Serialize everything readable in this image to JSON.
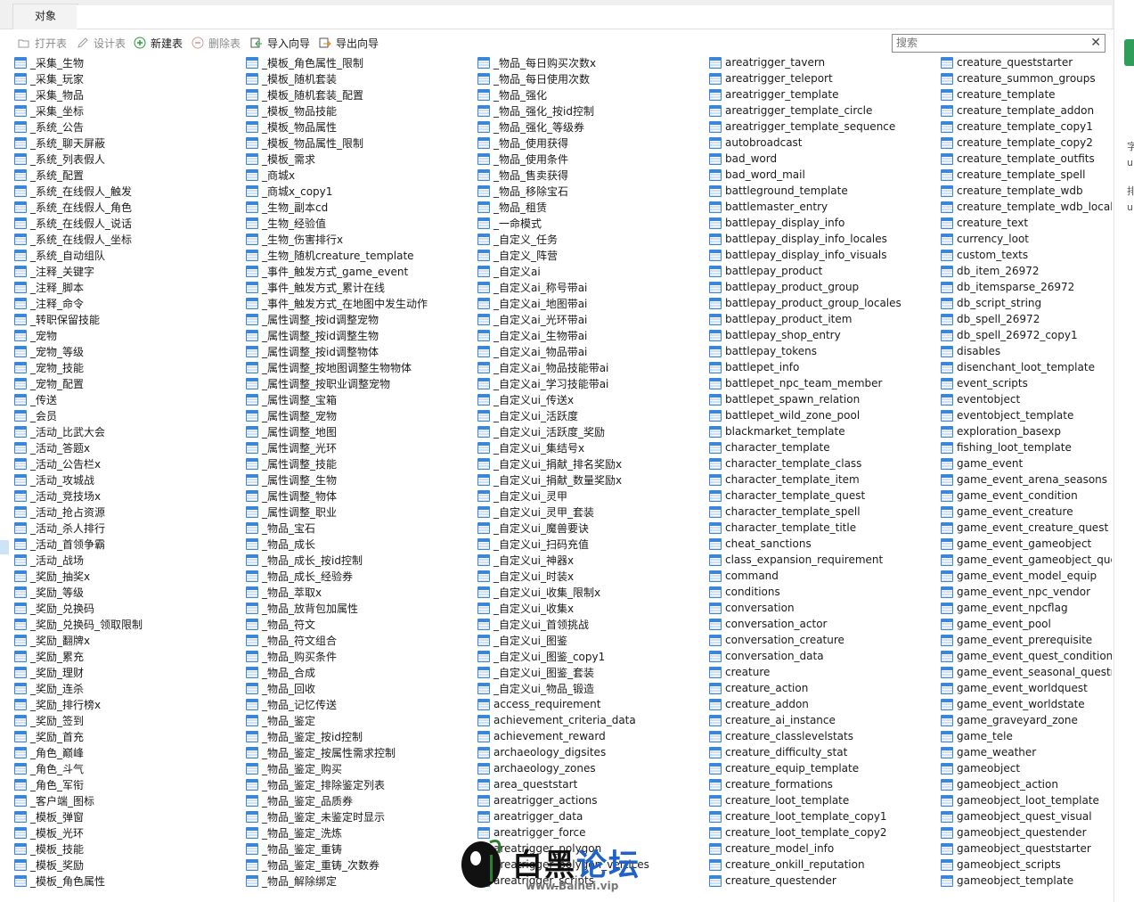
{
  "tab": {
    "label": "对象"
  },
  "toolbar": {
    "open": "打开表",
    "design": "设计表",
    "new": "新建表",
    "delete": "删除表",
    "import": "导入向导",
    "export": "导出向导"
  },
  "search": {
    "placeholder": "搜索"
  },
  "sidebar": {
    "t1": "字",
    "t2": "u",
    "t3": "排",
    "t4": "u"
  },
  "watermark": {
    "title_dark": "白黑",
    "title_blue": "论坛",
    "url": "www.Baihei.vip"
  },
  "columns": [
    [
      "_采集_生物",
      "_采集_玩家",
      "_采集_物品",
      "_采集_坐标",
      "_系统_公告",
      "_系统_聊天屏蔽",
      "_系统_列表假人",
      "_系统_配置",
      "_系统_在线假人_触发",
      "_系统_在线假人_角色",
      "_系统_在线假人_说话",
      "_系统_在线假人_坐标",
      "_系统_自动组队",
      "_注释_关键字",
      "_注释_脚本",
      "_注释_命令",
      "_转职保留技能",
      "_宠物",
      "_宠物_等级",
      "_宠物_技能",
      "_宠物_配置",
      "_传送",
      "_会员",
      "_活动_比武大会",
      "_活动_答题x",
      "_活动_公告栏x",
      "_活动_攻城战",
      "_活动_竞技场x",
      "_活动_抢占资源",
      "_活动_杀人排行",
      "_活动_首领争霸",
      "_活动_战场",
      "_奖励_抽奖x",
      "_奖励_等级",
      "_奖励_兑换码",
      "_奖励_兑换码_领取限制",
      "_奖励_翻牌x",
      "_奖励_累充",
      "_奖励_理财",
      "_奖励_连杀",
      "_奖励_排行榜x",
      "_奖励_签到",
      "_奖励_首充",
      "_角色_巅峰",
      "_角色_斗气",
      "_角色_军衔",
      "_客户端_图标",
      "_模板_弹窗",
      "_模板_光环",
      "_模板_技能",
      "_模板_奖励",
      "_模板_角色属性"
    ],
    [
      "_模板_角色属性_限制",
      "_模板_随机套装",
      "_模板_随机套装_配置",
      "_模板_物品技能",
      "_模板_物品属性",
      "_模板_物品属性_限制",
      "_模板_需求",
      "_商城x",
      "_商城x_copy1",
      "_生物_副本cd",
      "_生物_经验值",
      "_生物_伤害排行x",
      "_生物_随机creature_template",
      "_事件_触发方式_game_event",
      "_事件_触发方式_累计在线",
      "_事件_触发方式_在地图中发生动作",
      "_属性调整_按id调整宠物",
      "_属性调整_按id调整生物",
      "_属性调整_按id调整物体",
      "_属性调整_按地图调整生物物体",
      "_属性调整_按职业调整宠物",
      "_属性调整_宝箱",
      "_属性调整_宠物",
      "_属性调整_地图",
      "_属性调整_光环",
      "_属性调整_技能",
      "_属性调整_生物",
      "_属性调整_物体",
      "_属性调整_职业",
      "_物品_宝石",
      "_物品_成长",
      "_物品_成长_按id控制",
      "_物品_成长_经验券",
      "_物品_萃取x",
      "_物品_放背包加属性",
      "_物品_符文",
      "_物品_符文组合",
      "_物品_购买条件",
      "_物品_合成",
      "_物品_回收",
      "_物品_记忆传送",
      "_物品_鉴定",
      "_物品_鉴定_按id控制",
      "_物品_鉴定_按属性需求控制",
      "_物品_鉴定_购买",
      "_物品_鉴定_排除鉴定列表",
      "_物品_鉴定_品质券",
      "_物品_鉴定_未鉴定时显示",
      "_物品_鉴定_洗炼",
      "_物品_鉴定_重铸",
      "_物品_鉴定_重铸_次数券",
      "_物品_解除绑定"
    ],
    [
      "_物品_每日购买次数x",
      "_物品_每日使用次数",
      "_物品_强化",
      "_物品_强化_按id控制",
      "_物品_强化_等级券",
      "_物品_使用获得",
      "_物品_使用条件",
      "_物品_售卖获得",
      "_物品_移除宝石",
      "_物品_租赁",
      "_一命模式",
      "_自定义_任务",
      "_自定义_阵营",
      "_自定义ai",
      "_自定义ai_称号带ai",
      "_自定义ai_地图带ai",
      "_自定义ai_光环带ai",
      "_自定义ai_生物带ai",
      "_自定义ai_物品带ai",
      "_自定义ai_物品技能带ai",
      "_自定义ai_学习技能带ai",
      "_自定义ui_传送x",
      "_自定义ui_活跃度",
      "_自定义ui_活跃度_奖励",
      "_自定义ui_集结号x",
      "_自定义ui_捐献_排名奖励x",
      "_自定义ui_捐献_数量奖励x",
      "_自定义ui_灵甲",
      "_自定义ui_灵甲_套装",
      "_自定义ui_魔兽要诀",
      "_自定义ui_扫码充值",
      "_自定义ui_神器x",
      "_自定义ui_时装x",
      "_自定义ui_收集_限制x",
      "_自定义ui_收集x",
      "_自定义ui_首领挑战",
      "_自定义ui_图鉴",
      "_自定义ui_图鉴_copy1",
      "_自定义ui_图鉴_套装",
      "_自定义ui_物品_锻造",
      "access_requirement",
      "achievement_criteria_data",
      "achievement_reward",
      "archaeology_digsites",
      "archaeology_zones",
      "area_queststart",
      "areatrigger_actions",
      "areatrigger_data",
      "areatrigger_force",
      "areatrigger_polygon",
      "areatrigger_polygon_vertices",
      "areatrigger_scripts"
    ],
    [
      "areatrigger_tavern",
      "areatrigger_teleport",
      "areatrigger_template",
      "areatrigger_template_circle",
      "areatrigger_template_sequence",
      "autobroadcast",
      "bad_word",
      "bad_word_mail",
      "battleground_template",
      "battlemaster_entry",
      "battlepay_display_info",
      "battlepay_display_info_locales",
      "battlepay_display_info_visuals",
      "battlepay_product",
      "battlepay_product_group",
      "battlepay_product_group_locales",
      "battlepay_product_item",
      "battlepay_shop_entry",
      "battlepay_tokens",
      "battlepet_info",
      "battlepet_npc_team_member",
      "battlepet_spawn_relation",
      "battlepet_wild_zone_pool",
      "blackmarket_template",
      "character_template",
      "character_template_class",
      "character_template_item",
      "character_template_quest",
      "character_template_spell",
      "character_template_title",
      "cheat_sanctions",
      "class_expansion_requirement",
      "command",
      "conditions",
      "conversation",
      "conversation_actor",
      "conversation_creature",
      "conversation_data",
      "creature",
      "creature_action",
      "creature_addon",
      "creature_ai_instance",
      "creature_classlevelstats",
      "creature_difficulty_stat",
      "creature_equip_template",
      "creature_formations",
      "creature_loot_template",
      "creature_loot_template_copy1",
      "creature_loot_template_copy2",
      "creature_model_info",
      "creature_onkill_reputation",
      "creature_questender"
    ],
    [
      "creature_queststarter",
      "creature_summon_groups",
      "creature_template",
      "creature_template_addon",
      "creature_template_copy1",
      "creature_template_copy2",
      "creature_template_outfits",
      "creature_template_spell",
      "creature_template_wdb",
      "creature_template_wdb_locale",
      "creature_text",
      "currency_loot",
      "custom_texts",
      "db_item_26972",
      "db_itemsparse_26972",
      "db_script_string",
      "db_spell_26972",
      "db_spell_26972_copy1",
      "disables",
      "disenchant_loot_template",
      "event_scripts",
      "eventobject",
      "eventobject_template",
      "exploration_basexp",
      "fishing_loot_template",
      "game_event",
      "game_event_arena_seasons",
      "game_event_condition",
      "game_event_creature",
      "game_event_creature_quest",
      "game_event_gameobject",
      "game_event_gameobject_quest",
      "game_event_model_equip",
      "game_event_npc_vendor",
      "game_event_npcflag",
      "game_event_pool",
      "game_event_prerequisite",
      "game_event_quest_condition",
      "game_event_seasonal_questrelation",
      "game_event_worldquest",
      "game_event_worldstate",
      "game_graveyard_zone",
      "game_tele",
      "game_weather",
      "gameobject",
      "gameobject_action",
      "gameobject_loot_template",
      "gameobject_quest_visual",
      "gameobject_questender",
      "gameobject_queststarter",
      "gameobject_scripts",
      "gameobject_template"
    ]
  ]
}
